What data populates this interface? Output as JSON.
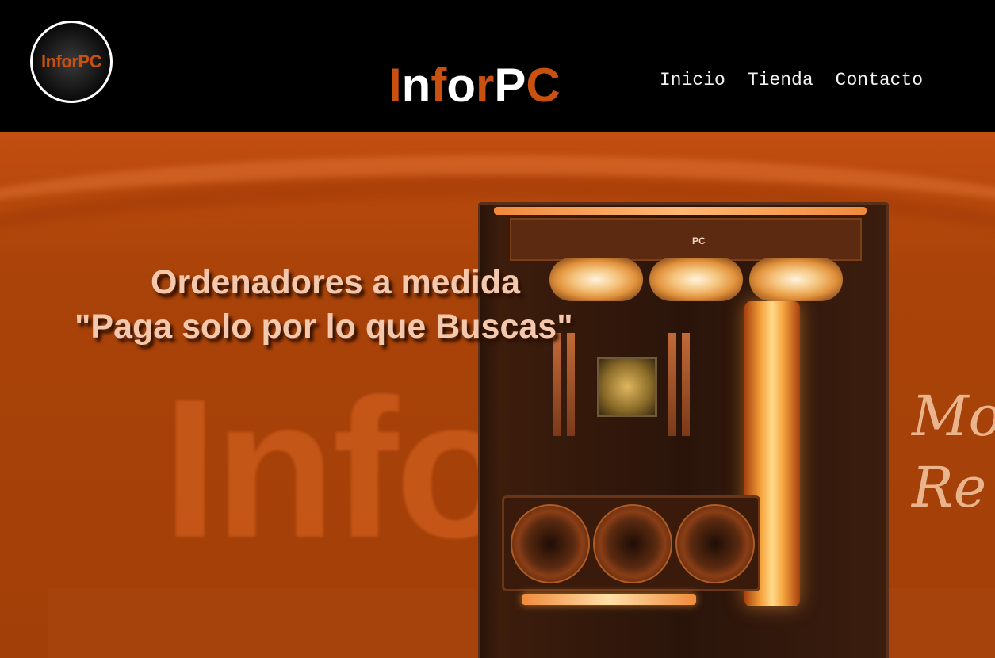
{
  "header": {
    "logo": {
      "part1": "Infor",
      "part2": "PC"
    },
    "brand": {
      "p1": "I",
      "p2": "n",
      "p3": "f",
      "p4": "o",
      "p5": "r",
      "p6": "P",
      "p7": "C"
    },
    "nav": [
      {
        "label": "Inicio"
      },
      {
        "label": "Tienda"
      },
      {
        "label": "Contacto"
      }
    ]
  },
  "hero": {
    "headline_line1": "Ordenadores a medida",
    "headline_line2": "\"Paga solo por lo que Buscas\"",
    "background_brand": {
      "a": "Infor",
      "b": ""
    },
    "background_script": {
      "line1": "Mo",
      "line2": "Re"
    },
    "pc_label": "PC"
  },
  "colors": {
    "accent_orange": "#c9510f",
    "hero_orange": "#a94309",
    "header_bg": "#000000"
  }
}
